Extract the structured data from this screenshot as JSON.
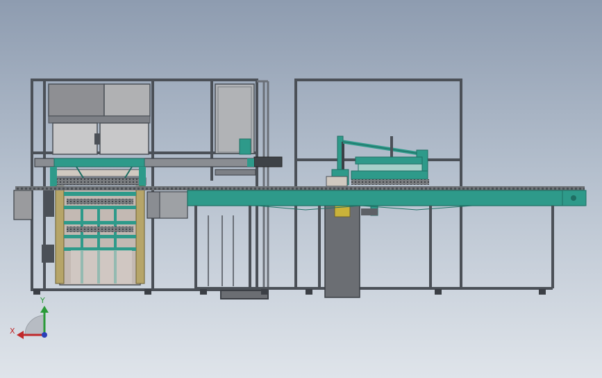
{
  "viewport": {
    "background_top": "#8e9cb0",
    "background_bottom": "#dfe4ea"
  },
  "colors": {
    "frame": "#5a5f66",
    "frame_dark": "#3b3f45",
    "conveyor": "#2e9a8a",
    "conveyor_dark": "#1f6e63",
    "panel": "#a9a9ab",
    "panel_light": "#c8c6c3",
    "accent_yellow": "#c9b23a",
    "block_dark": "#6b6e73"
  },
  "triad": {
    "x_label": "X",
    "y_label": "Y",
    "x_color": "#c0282a",
    "y_color": "#2a9a38",
    "z_color": "#2a3fb8"
  },
  "objects": {
    "machine_left": "left-cell-frame",
    "machine_right": "right-cell-frame",
    "conveyor": "main-conveyor"
  }
}
